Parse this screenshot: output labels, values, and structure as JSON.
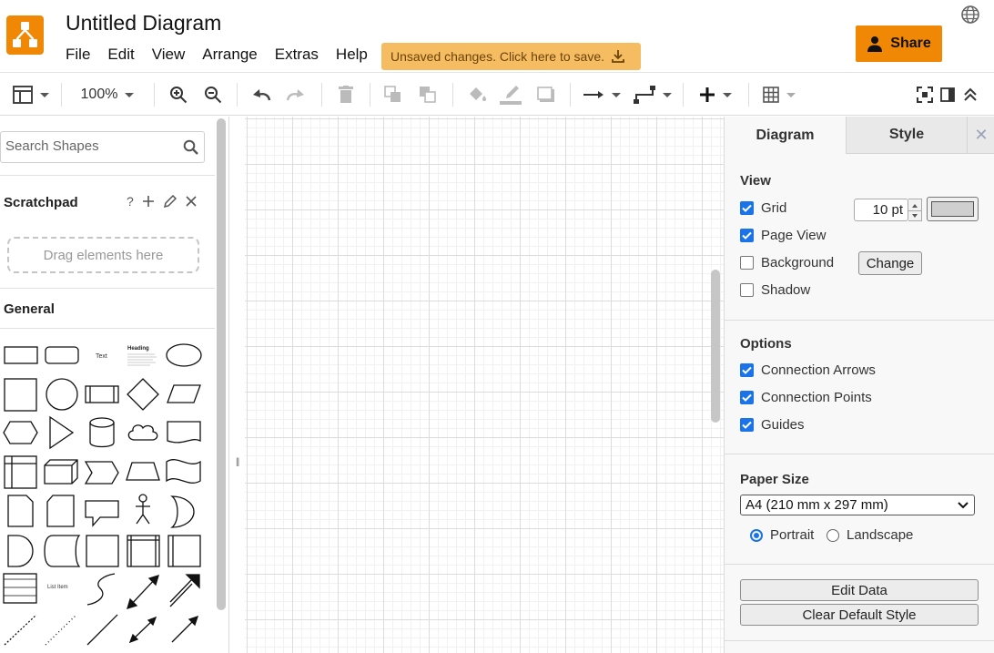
{
  "app": {
    "title": "Untitled Diagram",
    "menu": [
      "File",
      "Edit",
      "View",
      "Arrange",
      "Extras",
      "Help"
    ],
    "unsaved_notice": "Unsaved changes. Click here to save.",
    "share_label": "Share",
    "accent_color": "#f08705"
  },
  "toolbar": {
    "zoom": "100%"
  },
  "left": {
    "search_placeholder": "Search Shapes",
    "scratchpad_title": "Scratchpad",
    "scratchpad_help": "?",
    "scratchpad_drop": "Drag elements here",
    "general_title": "General",
    "shape_text_label": "Text",
    "shape_heading_label": "Heading",
    "shape_list_item_label": "List Item"
  },
  "right": {
    "tabs": [
      "Diagram",
      "Style"
    ],
    "view": {
      "title": "View",
      "grid_label": "Grid",
      "grid_checked": true,
      "grid_size": "10 pt",
      "page_view_label": "Page View",
      "page_view_checked": true,
      "background_label": "Background",
      "background_checked": false,
      "change_label": "Change",
      "shadow_label": "Shadow",
      "shadow_checked": false
    },
    "options": {
      "title": "Options",
      "connection_arrows": "Connection Arrows",
      "connection_points": "Connection Points",
      "guides": "Guides"
    },
    "paper": {
      "title": "Paper Size",
      "selected": "A4 (210 mm x 297 mm)",
      "portrait": "Portrait",
      "landscape": "Landscape",
      "orientation": "Portrait"
    },
    "buttons": {
      "edit_data": "Edit Data",
      "clear_default_style": "Clear Default Style"
    }
  }
}
